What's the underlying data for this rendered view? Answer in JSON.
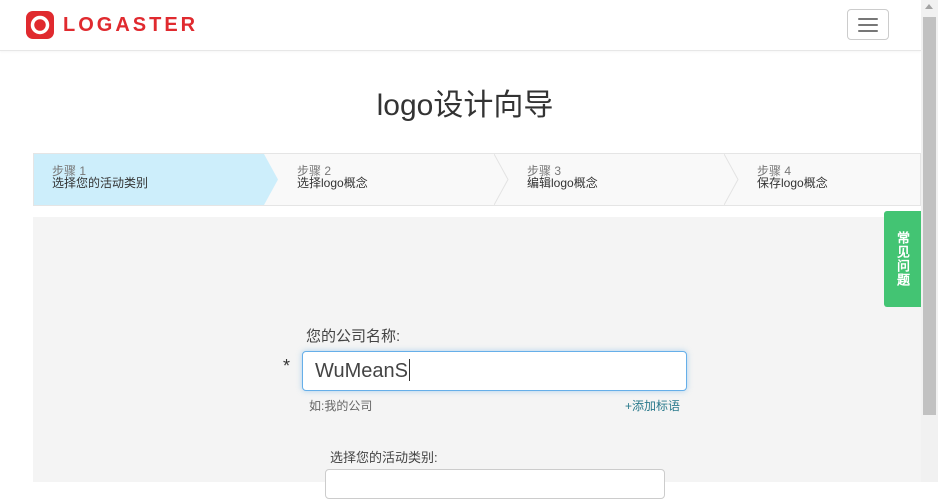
{
  "header": {
    "logo_text": "LOGASTER",
    "brand_color": "#e02a2f",
    "menu_icon": "hamburger-icon"
  },
  "page": {
    "title": "logo设计向导"
  },
  "steps": [
    {
      "number": "步骤 1",
      "name": "选择您的活动类别",
      "active": true
    },
    {
      "number": "步骤 2",
      "name": "选择logo概念",
      "active": false
    },
    {
      "number": "步骤 3",
      "name": "编辑logo概念",
      "active": false
    },
    {
      "number": "步骤 4",
      "name": "保存logo概念",
      "active": false
    }
  ],
  "form": {
    "company_label": "您的公司名称:",
    "required_mark": "*",
    "company_value": "WuMeanS",
    "hint": "如:我的公司",
    "add_slogan": "+添加标语",
    "activity_label": "选择您的活动类别:"
  },
  "faq": {
    "label": "常见问题",
    "color": "#43c473"
  }
}
